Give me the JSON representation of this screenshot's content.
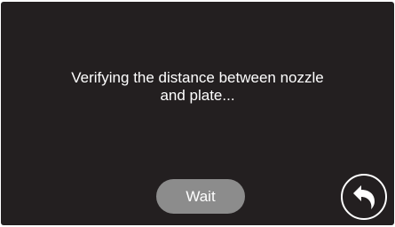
{
  "dialog": {
    "message_line1": "Verifying the distance between nozzle",
    "message_line2": "and plate..."
  },
  "buttons": {
    "wait_label": "Wait",
    "back_icon": "return-arrow-icon"
  },
  "colors": {
    "screen_background": "#231f20",
    "text": "#ffffff",
    "wait_button_background": "#8c8c8c"
  }
}
